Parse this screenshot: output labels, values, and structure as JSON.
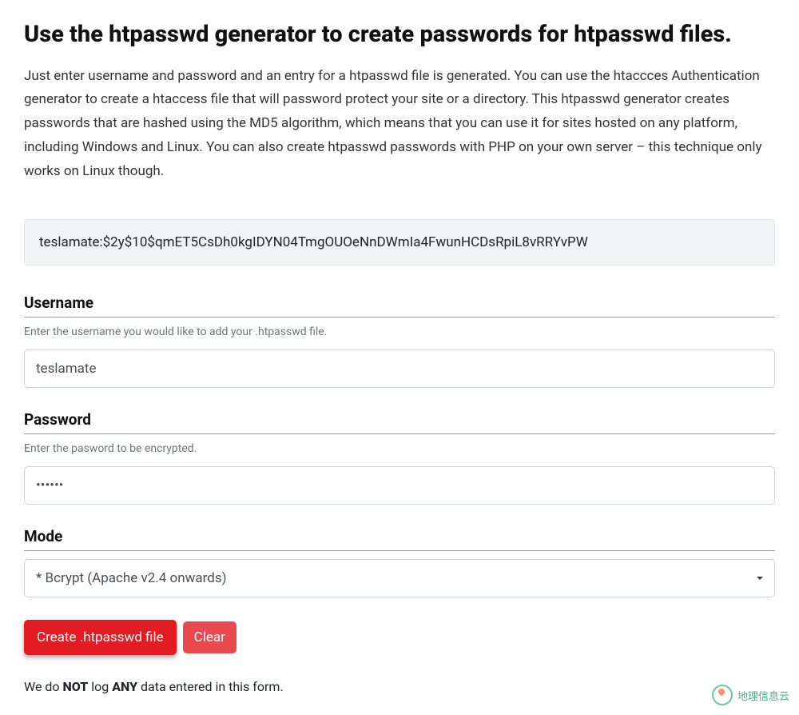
{
  "heading": "Use the htpasswd generator to create passwords for htpasswd files.",
  "intro": "Just enter username and password and an entry for a htpasswd file is generated. You can use the htaccces Authentication generator to create a htaccess file that will password protect your site or a directory. This htpasswd generator creates passwords that are hashed using the MD5 algorithm, which means that you can use it for sites hosted on any platform, including Windows and Linux. You can also create htpasswd passwords with PHP on your own server – this technique only works on Linux though.",
  "output": "teslamate:$2y$10$qmET5CsDh0kgIDYN04TmgOUOeNnDWmIa4FwunHCDsRpiL8vRRYvPW",
  "username": {
    "label": "Username",
    "hint": "Enter the username you would like to add your .htpasswd file.",
    "value": "teslamate"
  },
  "password": {
    "label": "Password",
    "hint": "Enter the pasword to be encrypted.",
    "value": "••••••"
  },
  "mode": {
    "label": "Mode",
    "selected": "* Bcrypt (Apache v2.4 onwards)"
  },
  "buttons": {
    "create": "Create .htpasswd file",
    "clear": "Clear"
  },
  "disclaimer": {
    "prefix": "We do ",
    "not": "NOT",
    "mid": " log ",
    "any": "ANY",
    "suffix": " data entered in this form."
  },
  "watermark": "地理信息云"
}
